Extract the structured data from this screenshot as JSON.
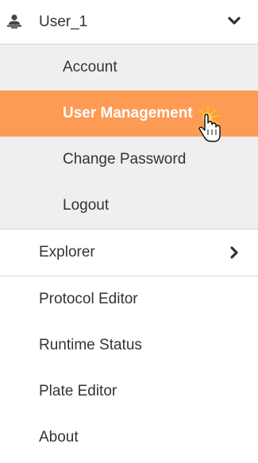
{
  "user_menu": {
    "username": "User_1",
    "icon": "user-desktop-icon",
    "expand_icon": "chevron-down-icon",
    "submenu": [
      {
        "label": "Account",
        "active": false
      },
      {
        "label": "User Management",
        "active": true
      },
      {
        "label": "Change Password",
        "active": false
      },
      {
        "label": "Logout",
        "active": false
      }
    ]
  },
  "nav": {
    "explorer": {
      "label": "Explorer",
      "icon": "chevron-right-icon"
    },
    "items": [
      {
        "label": "Protocol Editor"
      },
      {
        "label": "Runtime Status"
      },
      {
        "label": "Plate Editor"
      },
      {
        "label": "About"
      }
    ]
  },
  "colors": {
    "active_bg": "#fd9b55",
    "submenu_bg": "#efefef",
    "text": "#333333",
    "divider": "#d6d6d6"
  }
}
